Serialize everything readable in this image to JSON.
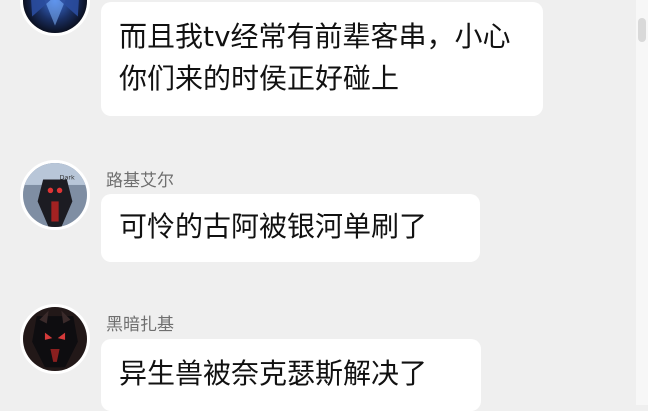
{
  "messages": [
    {
      "sender": "",
      "text": "而且我tv经常有前辈客串，小心你们来的时侯正好碰上",
      "avatar_icon": "dark-mech-avatar-icon"
    },
    {
      "sender": "路基艾尔",
      "text": "可怜的古阿被银河单刷了",
      "avatar_icon": "dark-hero-avatar-icon"
    },
    {
      "sender": "黑暗扎基",
      "text": "异生兽被奈克瑟斯解决了",
      "avatar_icon": "dark-zagi-avatar-icon"
    }
  ],
  "colors": {
    "background": "#efefef",
    "bubble": "#ffffff",
    "sender_name": "#6f6f6f",
    "text": "#111111"
  }
}
